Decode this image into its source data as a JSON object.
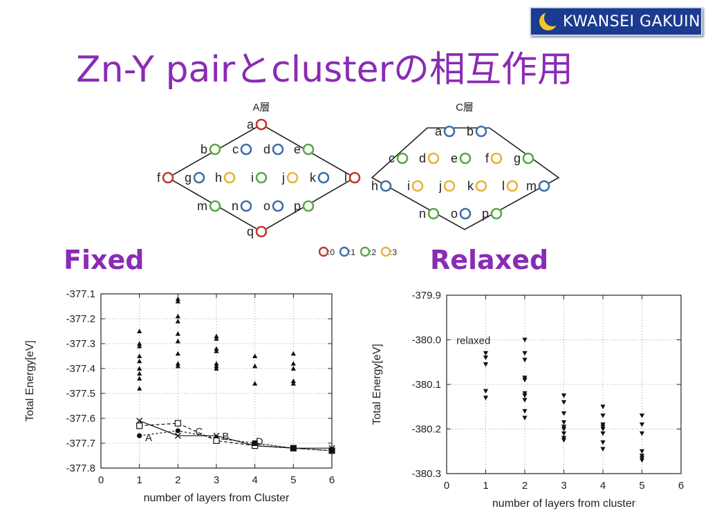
{
  "title": "Zn-Y pairとclusterの相互作用",
  "logo_text": "KWANSEI GAKUIN",
  "section_fixed": "Fixed",
  "section_relaxed": "Relaxed",
  "colors": {
    "title": "#8a2bb5",
    "level0": "#c0392b",
    "level1": "#3d6fa8",
    "level2": "#58a845",
    "level3": "#e8b23a"
  },
  "diagram_A": {
    "title": "A層",
    "rows": [
      [
        {
          "l": "a",
          "c": 0
        }
      ],
      [
        {
          "l": "b",
          "c": 2
        },
        {
          "l": "c",
          "c": 1
        },
        {
          "l": "d",
          "c": 1
        },
        {
          "l": "e",
          "c": 2
        }
      ],
      [
        {
          "l": "f",
          "c": 0
        },
        {
          "l": "g",
          "c": 1
        },
        {
          "l": "h",
          "c": 3
        },
        {
          "l": "i",
          "c": 2
        },
        {
          "l": "j",
          "c": 3
        },
        {
          "l": "k",
          "c": 1
        },
        {
          "l": "l",
          "c": 0
        }
      ],
      [
        {
          "l": "m",
          "c": 2
        },
        {
          "l": "n",
          "c": 1
        },
        {
          "l": "o",
          "c": 1
        },
        {
          "l": "p",
          "c": 2
        }
      ],
      [
        {
          "l": "q",
          "c": 0
        }
      ]
    ]
  },
  "diagram_C": {
    "title": "C層",
    "rows": [
      [
        {
          "l": "a",
          "c": 1
        },
        {
          "l": "b",
          "c": 1
        }
      ],
      [
        {
          "l": "c",
          "c": 2
        },
        {
          "l": "d",
          "c": 3
        },
        {
          "l": "e",
          "c": 2
        },
        {
          "l": "f",
          "c": 3
        },
        {
          "l": "g",
          "c": 2
        }
      ],
      [
        {
          "l": "h",
          "c": 1
        },
        {
          "l": "i",
          "c": 3
        },
        {
          "l": "j",
          "c": 3
        },
        {
          "l": "k",
          "c": 3
        },
        {
          "l": "l",
          "c": 3
        },
        {
          "l": "m",
          "c": 1
        }
      ],
      [
        {
          "l": "n",
          "c": 2
        },
        {
          "l": "o",
          "c": 1
        },
        {
          "l": "p",
          "c": 2
        }
      ]
    ]
  },
  "legend": [
    ":0",
    ":1",
    ":2",
    ":3"
  ],
  "chart_data": [
    {
      "type": "scatter",
      "xlabel": "number of layers from Cluster",
      "ylabel": "Total Energy[eV]",
      "xlim": [
        0,
        6
      ],
      "ylim": [
        -377.8,
        -377.1
      ],
      "xticks": [
        "0",
        "1",
        "2",
        "3",
        "4",
        "5",
        "6"
      ],
      "yticks": [
        "-377.1",
        "-377.2",
        "-377.3",
        "-377.4",
        "-377.5",
        "-377.6",
        "-377.7",
        "-377.8"
      ],
      "grid": true,
      "scatter": [
        {
          "x": 1,
          "y": -377.25
        },
        {
          "x": 1,
          "y": -377.3
        },
        {
          "x": 1,
          "y": -377.31
        },
        {
          "x": 1,
          "y": -377.35
        },
        {
          "x": 1,
          "y": -377.37
        },
        {
          "x": 1,
          "y": -377.4
        },
        {
          "x": 1,
          "y": -377.42
        },
        {
          "x": 1,
          "y": -377.44
        },
        {
          "x": 1,
          "y": -377.48
        },
        {
          "x": 2,
          "y": -377.12
        },
        {
          "x": 2,
          "y": -377.13
        },
        {
          "x": 2,
          "y": -377.19
        },
        {
          "x": 2,
          "y": -377.21
        },
        {
          "x": 2,
          "y": -377.26
        },
        {
          "x": 2,
          "y": -377.29
        },
        {
          "x": 2,
          "y": -377.34
        },
        {
          "x": 2,
          "y": -377.38
        },
        {
          "x": 2,
          "y": -377.39
        },
        {
          "x": 3,
          "y": -377.27
        },
        {
          "x": 3,
          "y": -377.28
        },
        {
          "x": 3,
          "y": -377.32
        },
        {
          "x": 3,
          "y": -377.33
        },
        {
          "x": 3,
          "y": -377.38
        },
        {
          "x": 3,
          "y": -377.39
        },
        {
          "x": 3,
          "y": -377.4
        },
        {
          "x": 4,
          "y": -377.35
        },
        {
          "x": 4,
          "y": -377.39
        },
        {
          "x": 4,
          "y": -377.46
        },
        {
          "x": 5,
          "y": -377.34
        },
        {
          "x": 5,
          "y": -377.38
        },
        {
          "x": 5,
          "y": -377.4
        },
        {
          "x": 5,
          "y": -377.45
        },
        {
          "x": 5,
          "y": -377.46
        }
      ],
      "series": [
        {
          "name": "A",
          "marker": "circle",
          "x": [
            1,
            2,
            3,
            4,
            5,
            6
          ],
          "y": [
            -377.67,
            -377.65,
            -377.68,
            -377.7,
            -377.72,
            -377.73
          ]
        },
        {
          "name": "B",
          "marker": "x",
          "x": [
            1,
            2,
            3,
            4,
            5,
            6
          ],
          "y": [
            -377.61,
            -377.67,
            -377.67,
            -377.71,
            -377.72,
            -377.72
          ]
        },
        {
          "name": "C",
          "marker": "square",
          "x": [
            1,
            2,
            3,
            4,
            5,
            6
          ],
          "y": [
            -377.63,
            -377.62,
            -377.69,
            -377.71,
            -377.72,
            -377.73
          ]
        },
        {
          "name": "D",
          "marker": "filled-square",
          "x": [
            4,
            5,
            6
          ],
          "y": [
            -377.7,
            -377.72,
            -377.73
          ]
        }
      ],
      "series_label_pos": [
        {
          "x": 1.15,
          "y": -377.675
        },
        {
          "x": 3.15,
          "y": -377.67
        },
        {
          "x": 2.45,
          "y": -377.65
        },
        {
          "x": 4.02,
          "y": -377.69
        }
      ]
    },
    {
      "type": "scatter",
      "xlabel": "number of layers from cluster",
      "ylabel": "Total Energy[eV]",
      "xlim": [
        0,
        6
      ],
      "ylim": [
        -380.3,
        -379.9
      ],
      "xticks": [
        "0",
        "1",
        "2",
        "3",
        "4",
        "5",
        "6"
      ],
      "yticks": [
        "-379.9",
        "-380.0",
        "-380.1",
        "-380.2",
        "-380.3"
      ],
      "grid": true,
      "annotation": "relaxed",
      "annotation_pos": {
        "x": 0.25,
        "y": -380.0
      },
      "scatter": [
        {
          "x": 1,
          "y": -380.03
        },
        {
          "x": 1,
          "y": -380.04
        },
        {
          "x": 1,
          "y": -380.055
        },
        {
          "x": 1,
          "y": -380.115
        },
        {
          "x": 1,
          "y": -380.13
        },
        {
          "x": 2,
          "y": -380.0
        },
        {
          "x": 2,
          "y": -380.03
        },
        {
          "x": 2,
          "y": -380.045
        },
        {
          "x": 2,
          "y": -380.085
        },
        {
          "x": 2,
          "y": -380.09
        },
        {
          "x": 2,
          "y": -380.12
        },
        {
          "x": 2,
          "y": -380.125
        },
        {
          "x": 2,
          "y": -380.135
        },
        {
          "x": 2,
          "y": -380.16
        },
        {
          "x": 2,
          "y": -380.175
        },
        {
          "x": 3,
          "y": -380.125
        },
        {
          "x": 3,
          "y": -380.14
        },
        {
          "x": 3,
          "y": -380.165
        },
        {
          "x": 3,
          "y": -380.185
        },
        {
          "x": 3,
          "y": -380.195
        },
        {
          "x": 3,
          "y": -380.2
        },
        {
          "x": 3,
          "y": -380.21
        },
        {
          "x": 3,
          "y": -380.22
        },
        {
          "x": 3,
          "y": -380.225
        },
        {
          "x": 4,
          "y": -380.15
        },
        {
          "x": 4,
          "y": -380.17
        },
        {
          "x": 4,
          "y": -380.19
        },
        {
          "x": 4,
          "y": -380.195
        },
        {
          "x": 4,
          "y": -380.2
        },
        {
          "x": 4,
          "y": -380.21
        },
        {
          "x": 4,
          "y": -380.23
        },
        {
          "x": 4,
          "y": -380.245
        },
        {
          "x": 5,
          "y": -380.17
        },
        {
          "x": 5,
          "y": -380.19
        },
        {
          "x": 5,
          "y": -380.21
        },
        {
          "x": 5,
          "y": -380.25
        },
        {
          "x": 5,
          "y": -380.26
        },
        {
          "x": 5,
          "y": -380.265
        },
        {
          "x": 5,
          "y": -380.27
        }
      ]
    }
  ]
}
